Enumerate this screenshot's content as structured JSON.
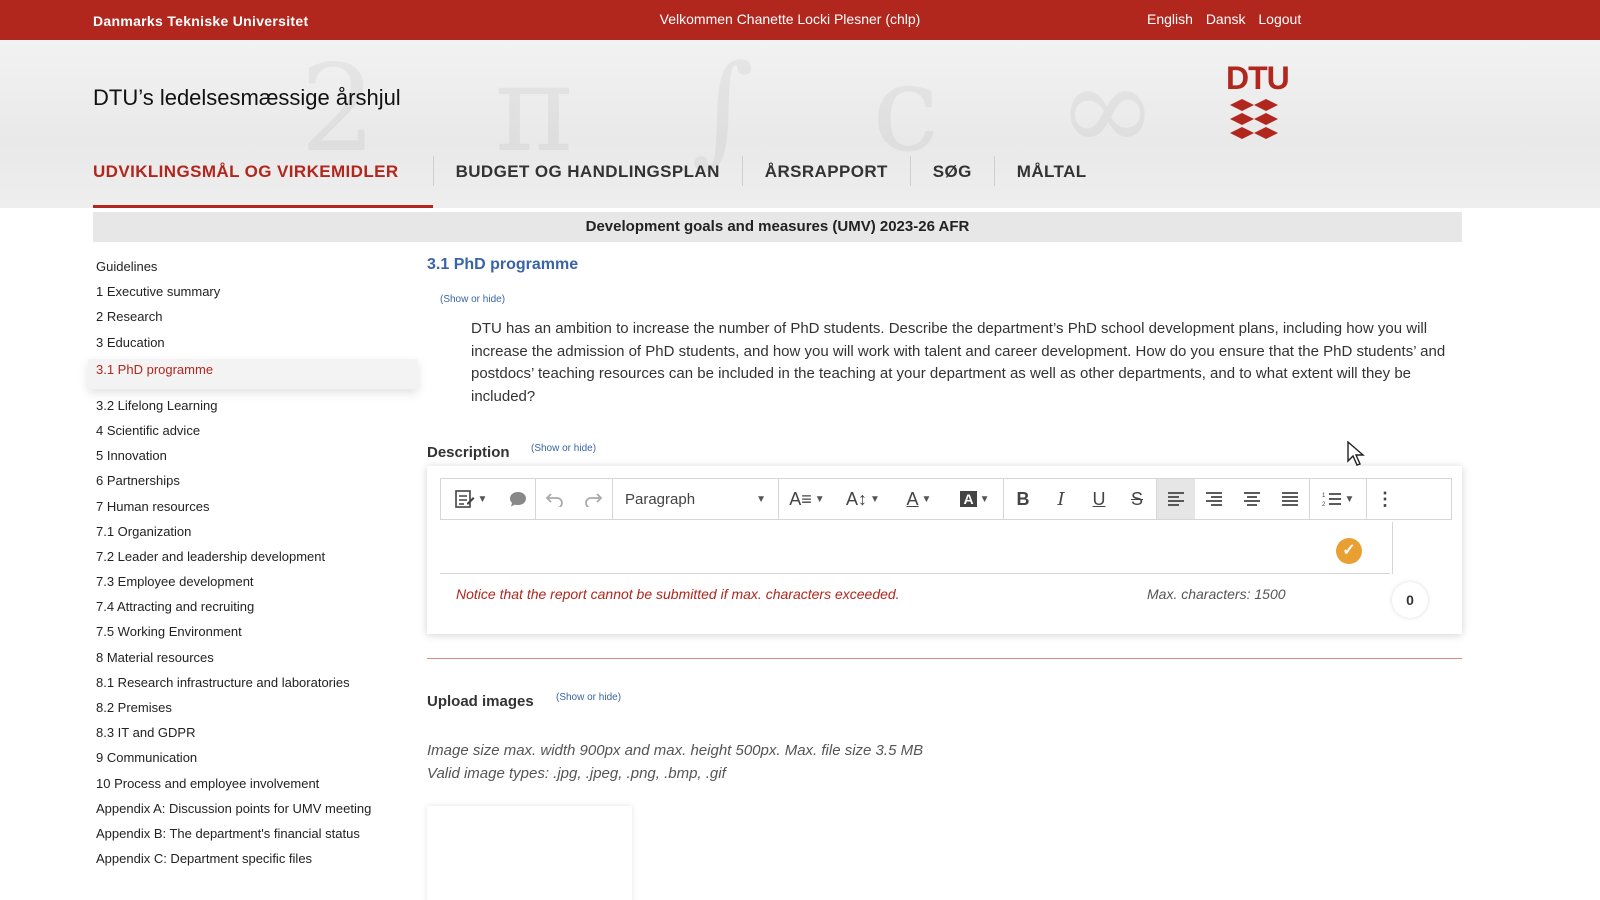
{
  "topbar": {
    "university": "Danmarks Tekniske Universitet",
    "welcome": "Velkommen Chanette Locki Plesner (chlp)",
    "lang_english": "English",
    "lang_dansk": "Dansk",
    "logout": "Logout"
  },
  "header": {
    "site_title": "DTU’s ledelsesmæssige årshjul",
    "logo_text": "DTU",
    "nav": [
      "UDVIKLINGSMÅL OG VIRKEMIDLER",
      "BUDGET OG HANDLINGSPLAN",
      "ÅRSRAPPORT",
      "SØG",
      "MÅLTAL"
    ]
  },
  "subtitle": "Development goals and measures (UMV) 2023-26 AFR",
  "sidebar": {
    "items": [
      "Guidelines",
      "1 Executive summary",
      "2 Research",
      "3 Education",
      "3.1 PhD programme",
      "3.2 Lifelong Learning",
      "4 Scientific advice",
      "5 Innovation",
      "6 Partnerships",
      "7 Human resources",
      "7.1 Organization",
      "7.2 Leader and leadership development",
      "7.3 Employee development",
      "7.4 Attracting and recruiting",
      "7.5 Working Environment",
      "8 Material resources",
      "8.1 Research infrastructure and laboratories",
      "8.2 Premises",
      "8.3 IT and GDPR",
      "9 Communication",
      "10 Process and employee involvement",
      "Appendix A: Discussion points for UMV meeting",
      "Appendix B: The department's financial status",
      "Appendix C: Department specific files"
    ],
    "active_index": 4
  },
  "main": {
    "section_title": "3.1 PhD programme",
    "show_or_hide": "(Show or hide)",
    "question": "DTU has an ambition to increase the number of PhD students. Describe the department’s PhD school development plans, including how you will increase the admission of PhD students, and how you will work with talent and career development. How do you ensure that the PhD students’ and postdocs’ teaching resources can be included in the teaching at your department as well as other departments, and to what extent will they be included?",
    "description_label": "Description",
    "editor": {
      "paragraph_select": "Paragraph",
      "notice": "Notice that the report cannot be submitted if max. characters exceeded.",
      "max_chars": "Max. characters: 1500",
      "char_count": "0"
    },
    "upload_label": "Upload images",
    "image_info_line1": "Image size max. width 900px and max. height 500px. Max. file size 3.5 MB",
    "image_info_line2": "Valid image types: .jpg, .jpeg, .png, .bmp, .gif"
  },
  "colors": {
    "brand_red": "#b1261d",
    "link_blue": "#3a64a8",
    "check_orange": "#e8a033"
  }
}
